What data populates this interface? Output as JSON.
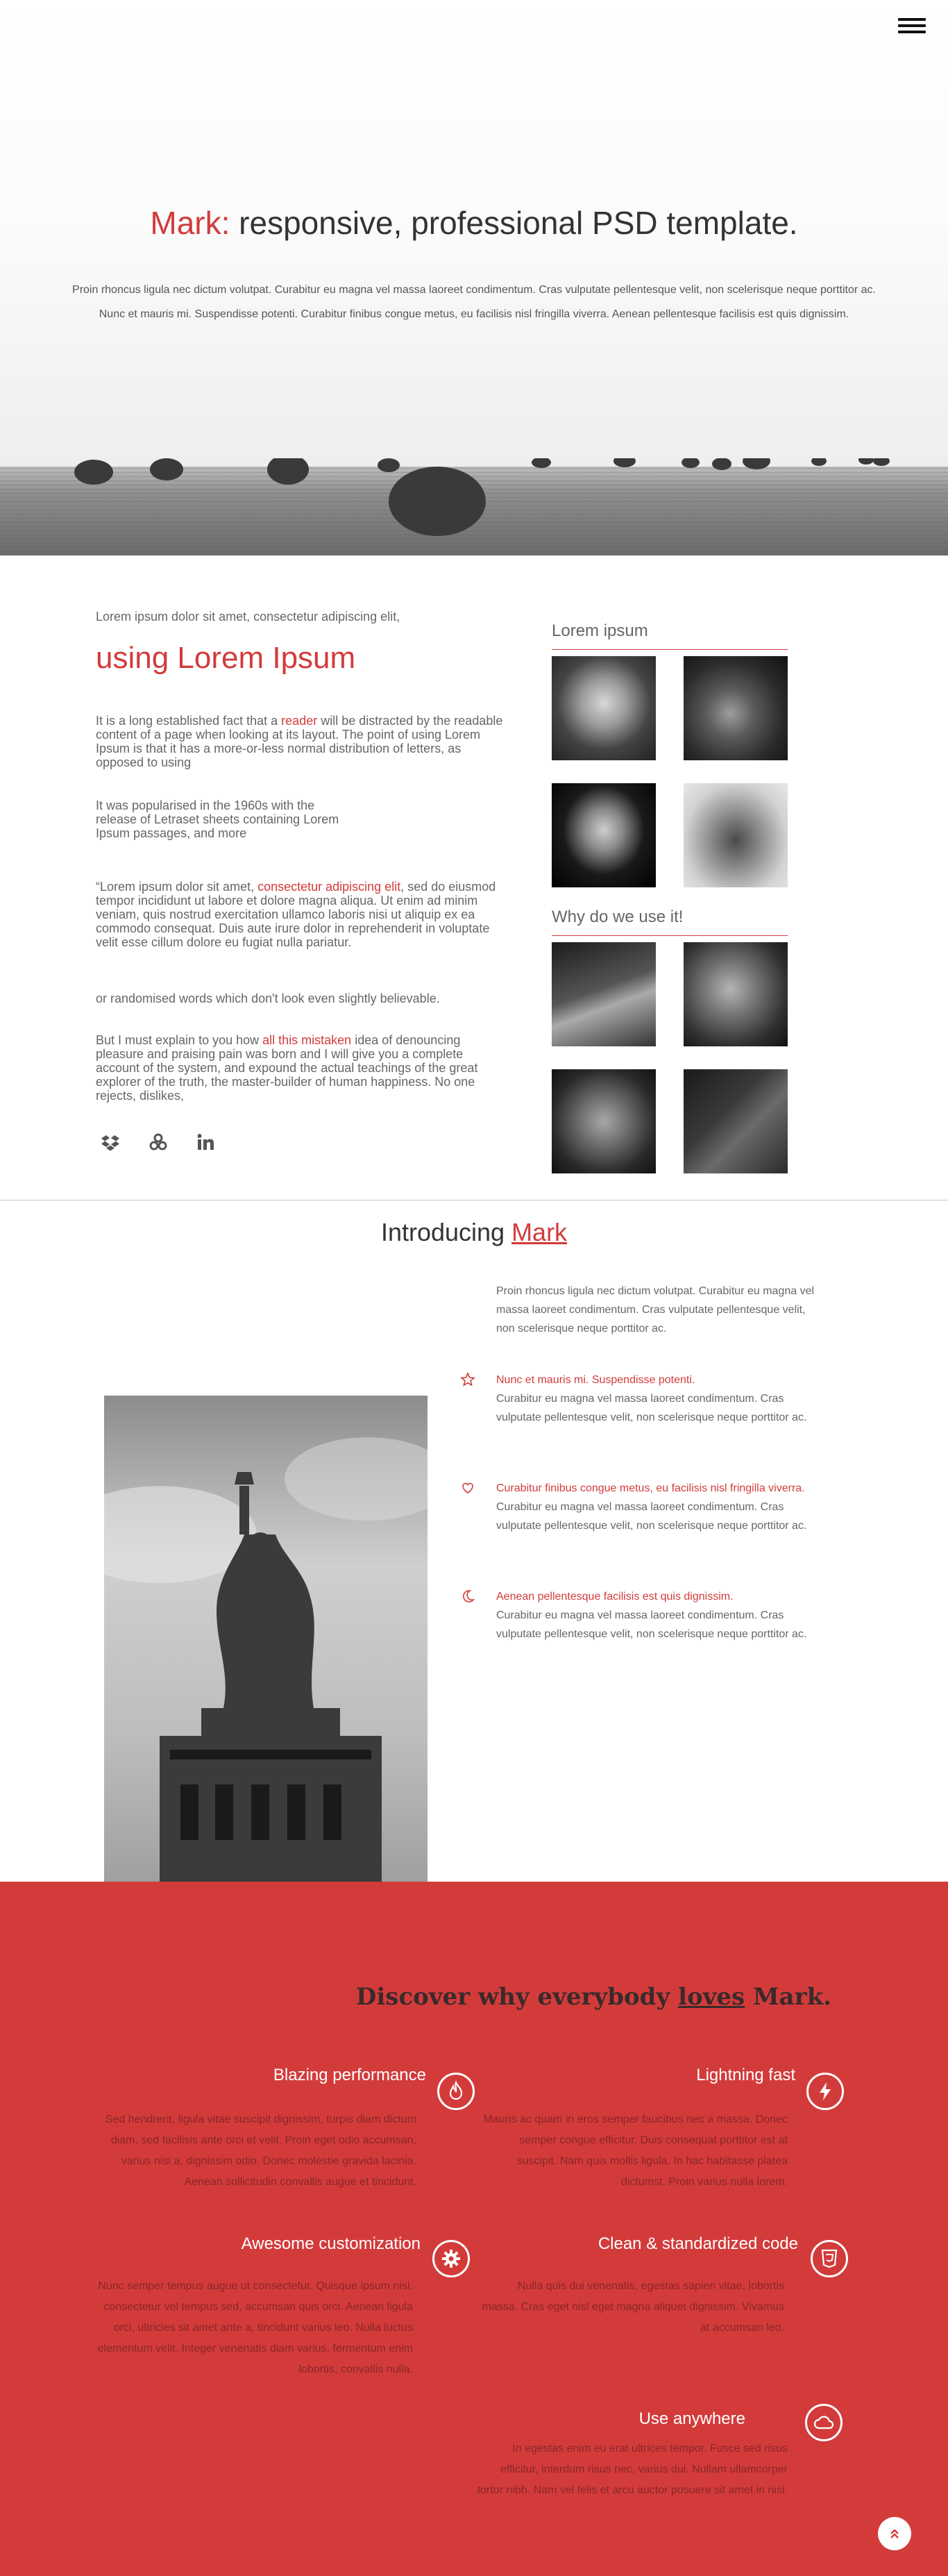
{
  "hero": {
    "title_accent": "Mark:",
    "title_rest": " responsive, professional PSD template.",
    "text": "Proin rhoncus ligula nec dictum volutpat. Curabitur eu magna vel massa laoreet condimentum. Cras vulputate pellentesque velit, non scelerisque neque porttitor ac. Nunc et mauris mi. Suspendisse potenti. Curabitur finibus congue metus, eu facilisis nisl fringilla viverra. Aenean pellentesque facilisis est quis dignissim."
  },
  "article": {
    "lead": "Lorem ipsum dolor sit amet, consectetur adipiscing elit,",
    "heading": "using Lorem Ipsum",
    "p1_a": "It is a long established fact that a ",
    "p1_link": "reader",
    "p1_b": " will be distracted by the readable content of a page when looking at its layout. The point of using Lorem Ipsum is that it has a more-or-less normal distribution of letters, as opposed to using",
    "p2": "It was popularised in the 1960s with the release of Letraset sheets containing Lorem Ipsum passages, and more",
    "p3_a": "“Lorem ipsum dolor sit amet, ",
    "p3_link": "consectetur adipiscing elit",
    "p3_b": ", sed do eiusmod tempor incididunt ut labore et dolore magna aliqua. Ut enim ad minim veniam, quis nostrud exercitation ullamco laboris nisi ut aliquip ex ea commodo consequat. Duis aute irure dolor in reprehenderit in voluptate velit esse cillum dolore eu fugiat nulla pariatur.",
    "p4": "or randomised words which don't look even slightly believable.",
    "p5_a": "But I must explain to you how ",
    "p5_link": "all this mistaken",
    "p5_b": " idea of denouncing pleasure and praising pain was born and I will give you a complete account of the system, and expound the actual teachings of the great explorer of the truth, the master-builder of human happiness. No one rejects, dislikes,"
  },
  "social": [
    "dropbox-icon",
    "share-icon",
    "linkedin-icon"
  ],
  "sidebar": {
    "title1": "Lorem ipsum",
    "title2": "Why do we use it!"
  },
  "intro": {
    "title": "Introducing ",
    "title_accent": "Mark",
    "lead": "Proin rhoncus ligula nec dictum volutpat. Curabitur eu magna vel massa laoreet condimentum. Cras vulputate pellentesque velit, non scelerisque neque porttitor ac.",
    "features": [
      {
        "icon": "star-icon",
        "title": "Nunc et mauris mi. Suspendisse potenti.",
        "text": "Curabitur eu magna vel massa laoreet condimentum. Cras vulputate pellentesque velit, non scelerisque neque porttitor ac."
      },
      {
        "icon": "heart-icon",
        "title": "Curabitur finibus congue metus, eu facilisis nisl fringilla viverra.",
        "text": "Curabitur eu magna vel massa laoreet condimentum. Cras vulputate pellentesque velit, non scelerisque neque porttitor ac."
      },
      {
        "icon": "moon-icon",
        "title": "Aenean pellentesque facilisis est quis dignissim.",
        "text": "Curabitur eu magna vel massa laoreet condimentum. Cras vulputate pellentesque velit, non scelerisque neque porttitor ac."
      }
    ]
  },
  "red": {
    "title_a": "Discover why everybody ",
    "title_u": "loves",
    "title_b": " Mark.",
    "features": [
      {
        "icon": "fire-icon",
        "title": "Blazing performance",
        "text": "Sed hendrerit, ligula vitae suscipit dignissim, turpis diam dictum diam, sed facilisis ante orci et velit. Proin eget odio accumsan, varius nisi a, dignissim odio. Donec molestie gravida lacinia. Aenean sollicitudin convallis augue et tincidunt."
      },
      {
        "icon": "lightning-icon",
        "title": "Lightning fast",
        "text": "Mauris ac quam in eros semper faucibus nec a massa. Donec semper congue efficitur. Duis consequat porttitor est at suscipit. Nam quis mollis ligula. In hac habitasse platea dictumst. Proin varius nulla lorem."
      },
      {
        "icon": "gear-icon",
        "title": "Awesome customization",
        "text": "Nunc semper tempus augue ut consectetur. Quisque ipsum nisl, consectetur vel tempus sed, accumsan quis orci. Aenean ligula orci, ultricies sit amet ante a, tincidunt varius leo. Nulla luctus elementum velit. Integer venenatis diam varius, fermentum enim lobortis, convallis nulla."
      },
      {
        "icon": "css3-icon",
        "title": "Clean & standardized code",
        "text": "Nulla quis dui venenatis, egestas sapien vitae, lobortis massa. Cras eget nisl eget magna aliquet dignissim. Vivamus at accumsan leo."
      },
      {
        "icon": "cloud-icon",
        "title": "Use anywhere",
        "text": "In egestas enim eu erat ultrices tempor. Fusce sed risus efficitur, interdum risus nec, varius dui. Nullam ullamcorper tortor nibh. Nam vel felis et arcu auctor posuere sit amet in nisi."
      }
    ]
  },
  "colors": {
    "accent": "#d33b3b",
    "red_text": "#8a2626"
  }
}
